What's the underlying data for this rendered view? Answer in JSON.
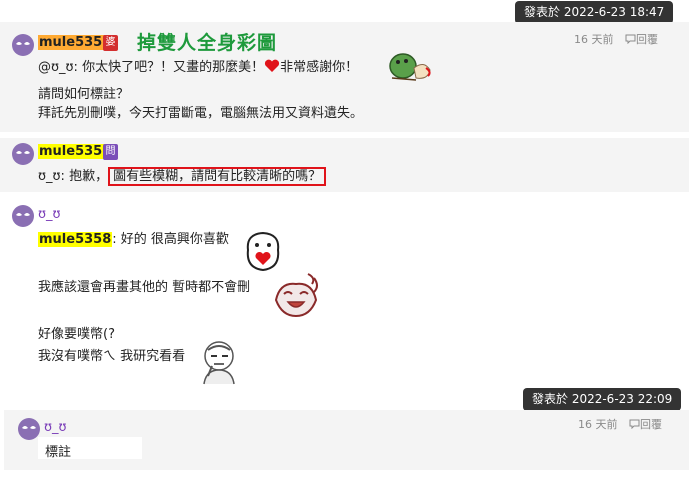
{
  "tooltips": [
    "發表於 2022-6-23 18:47",
    "發表於 2022-6-23 22:09"
  ],
  "comments": [
    {
      "username": "mule5358",
      "badge": "婆",
      "badge_color": "#d32f2f",
      "title": "掉雙人全身彩圖",
      "time": "16 天前",
      "reply": "回覆",
      "lines": [
        "@ʊ_ʊ: 你太快了吧？！又畫的那麼美！",
        "非常感謝你！",
        "請問如何標註？",
        "拜託先別刪噗，今天打雷斷電，電腦無法用又資料遺失。"
      ]
    },
    {
      "username": "mule5358",
      "badge": "問",
      "badge_color": "#7b4fb8",
      "prefix": "ʊ_ʊ: 抱歉，",
      "highlighted": "圖有些模糊，請問有比較清晰的嗎？"
    },
    {
      "username": "ʊ_ʊ",
      "mention": "mule5358",
      "lines": [
        ": 好的 很高興你喜歡",
        "我應該還會再畫其他的 暫時都不會刪",
        "好像要噗幣(?",
        "我沒有噗幣ㄟ 我研究看看"
      ]
    },
    {
      "username": "ʊ_ʊ",
      "time": "16 天前",
      "reply": "回覆",
      "lines": [
        "標註"
      ]
    }
  ],
  "colors": {
    "orange_highlight": "#ffaa33",
    "yellow_highlight": "#ffff00",
    "username_purple": "#7a3db8",
    "heart": "#e0131a"
  }
}
